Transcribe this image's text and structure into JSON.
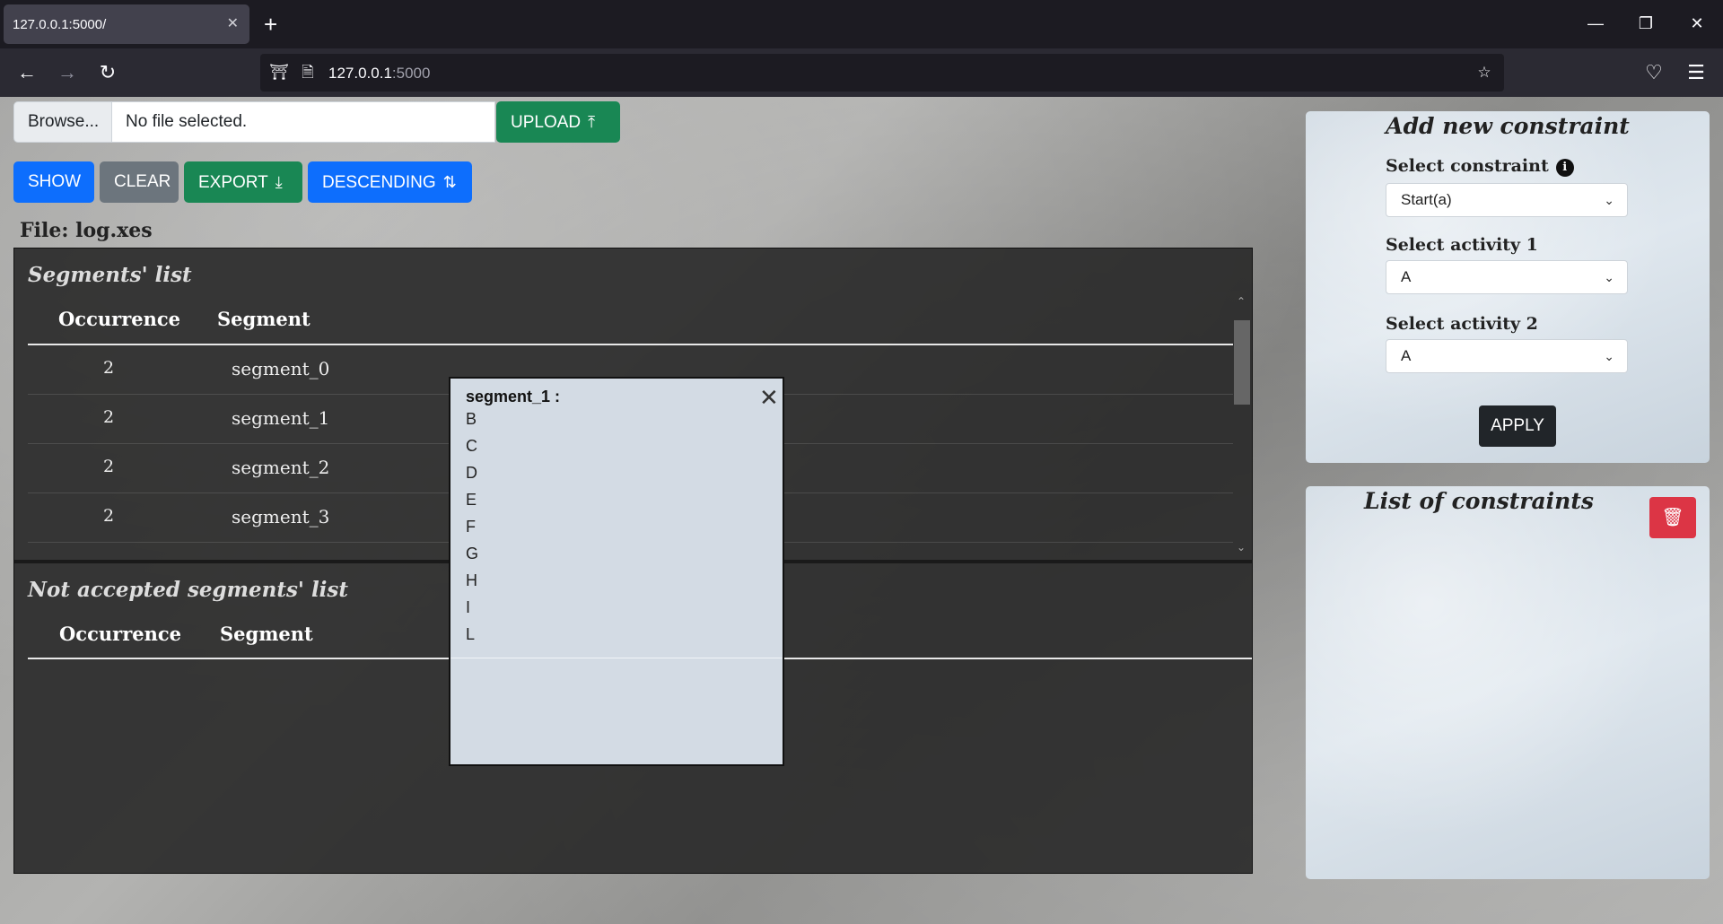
{
  "browser": {
    "tab_title": "127.0.0.1:5000/",
    "tab_close": "✕",
    "new_tab": "+",
    "url_host": "127.0.0.1",
    "url_port": ":5000"
  },
  "upload": {
    "browse_label": "Browse...",
    "file_status": "No file selected.",
    "upload_label": "UPLOAD"
  },
  "toolbar": {
    "show_label": "SHOW",
    "clear_label": "CLEAR",
    "export_label": "EXPORT",
    "sort_label": "DESCENDING"
  },
  "file_label": "File: log.xes",
  "segments": {
    "title": "Segments' list",
    "col_occurrence": "Occurrence",
    "col_segment": "Segment",
    "rows": [
      {
        "occurrence": "2",
        "segment": "segment_0"
      },
      {
        "occurrence": "2",
        "segment": "segment_1"
      },
      {
        "occurrence": "2",
        "segment": "segment_2"
      },
      {
        "occurrence": "2",
        "segment": "segment_3"
      }
    ]
  },
  "not_accepted": {
    "title": "Not accepted segments' list",
    "col_occurrence": "Occurrence",
    "col_segment": "Segment"
  },
  "popup": {
    "title": "segment_1 :",
    "items": [
      "B",
      "C",
      "D",
      "E",
      "F",
      "G",
      "H",
      "I",
      "L"
    ]
  },
  "add_constraint": {
    "title": "Add new constraint",
    "constraint_label": "Select constraint",
    "constraint_value": "Start(a)",
    "activity1_label": "Select activity 1",
    "activity1_value": "A",
    "activity2_label": "Select activity 2",
    "activity2_value": "A",
    "apply_label": "APPLY"
  },
  "constraints_list": {
    "title": "List of constraints"
  }
}
